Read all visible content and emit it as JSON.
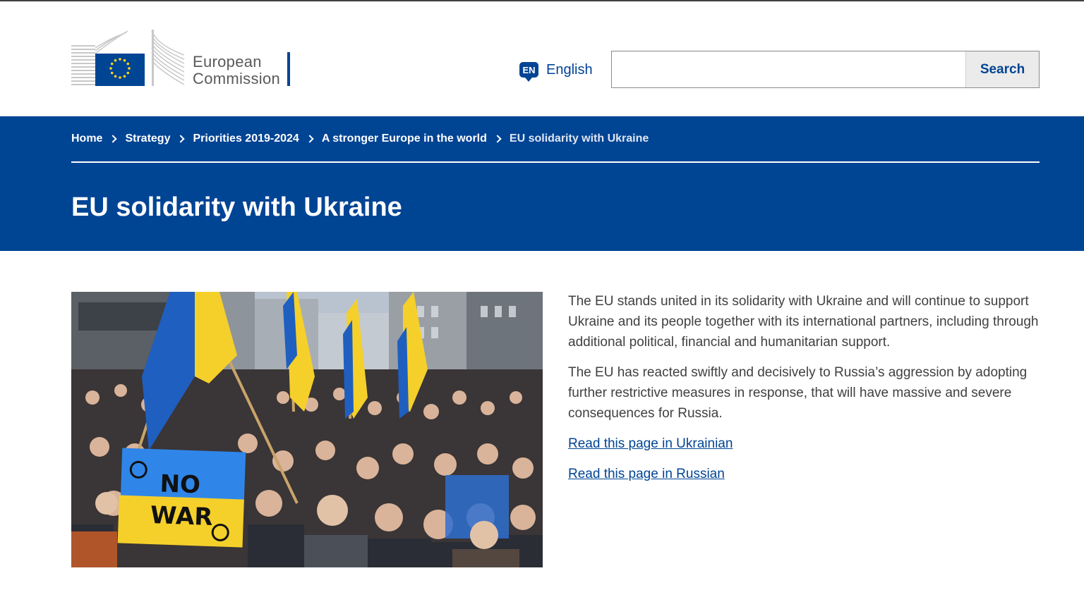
{
  "header": {
    "logo": {
      "line1": "European",
      "line2": "Commission"
    },
    "language": {
      "code": "EN",
      "label": "English"
    },
    "search": {
      "placeholder": "",
      "button_label": "Search"
    }
  },
  "breadcrumb": [
    {
      "label": "Home"
    },
    {
      "label": "Strategy"
    },
    {
      "label": "Priorities 2019-2024"
    },
    {
      "label": "A stronger Europe in the world"
    },
    {
      "label": "EU solidarity with Ukraine"
    }
  ],
  "page_title": "EU solidarity with Ukraine",
  "hero_image": {
    "sign_text_line1": "NO",
    "sign_text_line2": "WAR"
  },
  "content": {
    "paragraphs": [
      "The EU stands united in its solidarity with Ukraine and will continue to support Ukraine and its people together with its international partners, including through additional political, financial and humanitarian support.",
      "The EU has reacted swiftly and decisively to Russia’s aggression by adopting further restrictive measures in response, that will have massive and severe consequences for Russia."
    ],
    "links": [
      {
        "label": "Read this page in Ukrainian"
      },
      {
        "label": "Read this page in Russian"
      }
    ]
  },
  "colors": {
    "brand_blue": "#004494",
    "eu_star_yellow": "#ffd617",
    "text": "#404040",
    "ukraine_blue": "#1f5fbf",
    "ukraine_yellow": "#f5d02b"
  }
}
